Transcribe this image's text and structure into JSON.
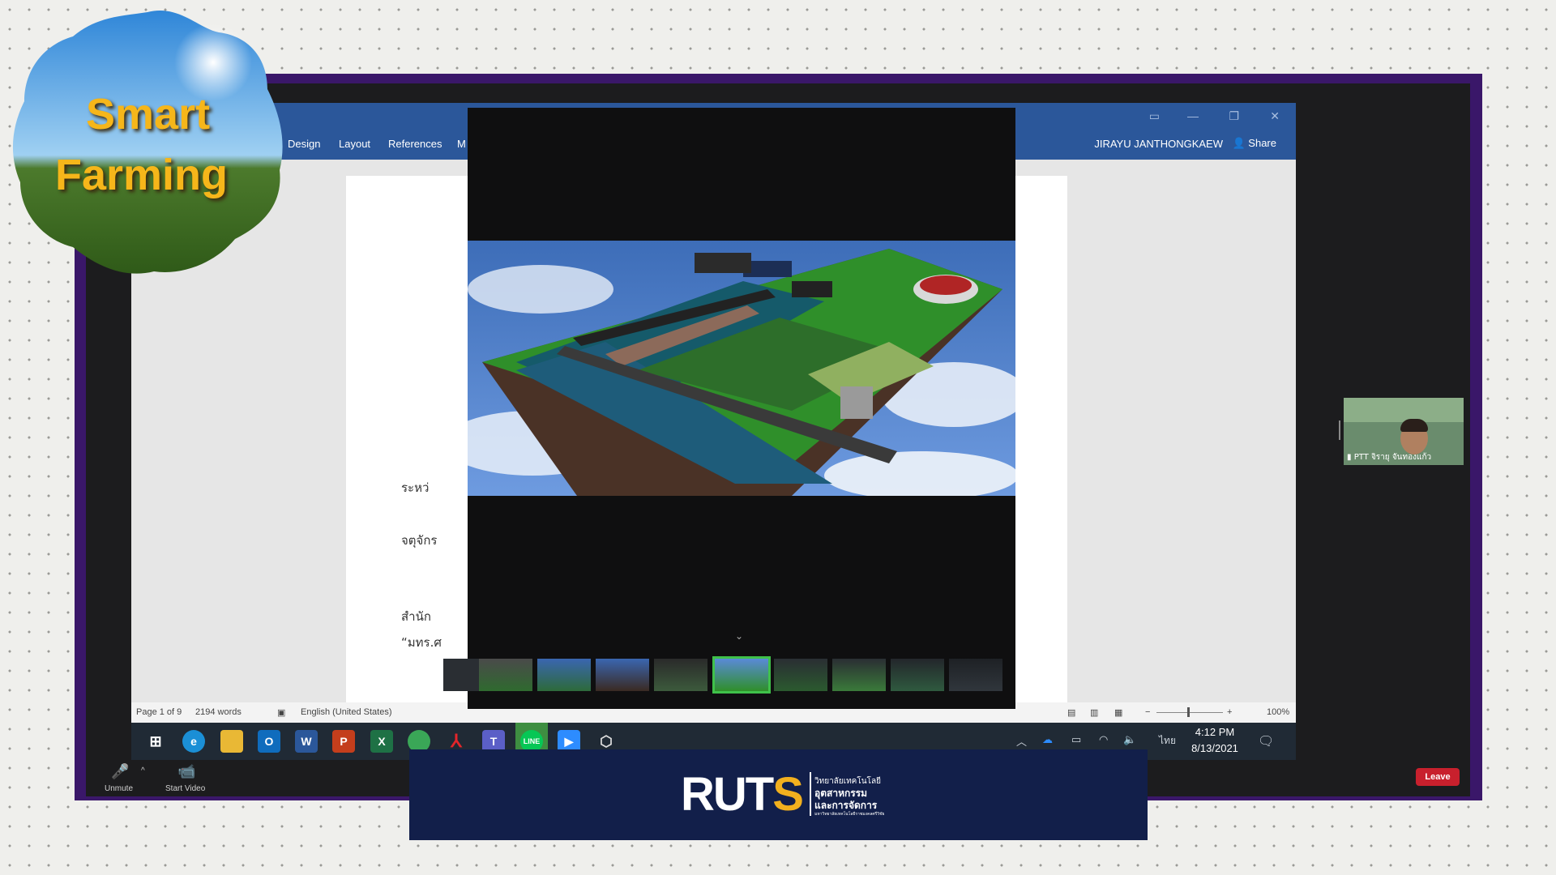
{
  "logo": {
    "line1": "Smart",
    "line2": "Farming"
  },
  "word": {
    "tabs": [
      "Design",
      "Layout",
      "References",
      "M"
    ],
    "user_name": "JIRAYU JANTHONGKAEW",
    "share_label": "Share",
    "body_lines": [
      "ระหว่",
      "จตุจักร",
      "สำนัก",
      "“มทร.ศ"
    ],
    "status": {
      "page": "Page 1 of 9",
      "words": "2194 words",
      "language": "English (United States)",
      "zoom": "100%"
    }
  },
  "taskbar": {
    "apps": [
      "start-icon",
      "edge-icon",
      "file-explorer-icon",
      "outlook-icon",
      "word-icon",
      "powerpoint-icon",
      "excel-icon",
      "photos-icon",
      "acrobat-icon",
      "teams-icon",
      "line-icon",
      "zoom-icon",
      "package-icon"
    ],
    "language": "ไทย",
    "time": "4:12 PM",
    "date": "8/13/2021"
  },
  "zoom": {
    "unmute_label": "Unmute",
    "start_video_label": "Start Video",
    "leave_label": "Leave",
    "participant_name": "PTT จิรายุ จันทองแก้ว"
  },
  "viewer": {
    "selected_thumbnail": 5,
    "thumbnail_count": 10
  },
  "banner": {
    "logo_text": "RUTS",
    "line1": "วิทยาลัยเทคโนโลยี",
    "line2": "อุตสาหกรรม",
    "line3": "และการจัดการ",
    "line4": "มหาวิทยาลัยเทคโนโลยีราชมงคลศรีวิชัย"
  },
  "colors": {
    "word_blue": "#2b579a",
    "zoom_purple": "#3a1769",
    "leave_red": "#c8202d",
    "banner_navy": "#121f4a",
    "ruts_gold": "#f2b01e"
  }
}
